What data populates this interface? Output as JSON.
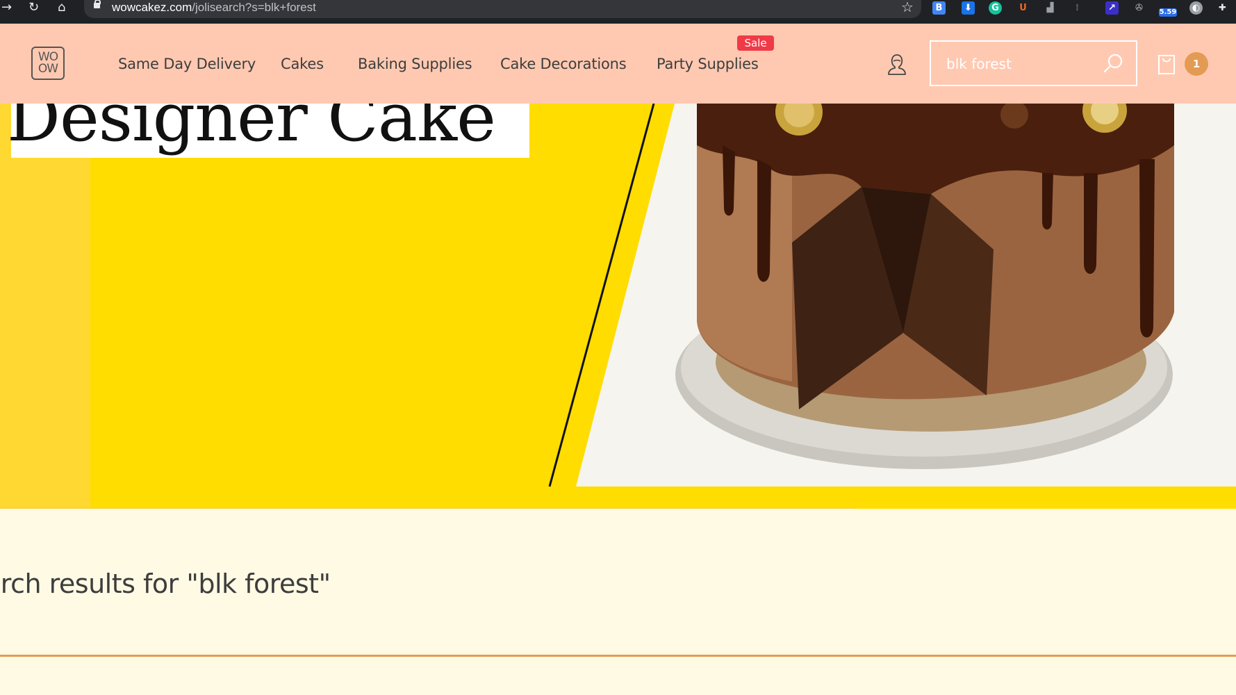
{
  "browser": {
    "url_host": "wowcakez.com",
    "url_path": "/jolisearch?s=blk+forest",
    "extension_badge": "5.59"
  },
  "header": {
    "logo_text": "WO OW",
    "nav": [
      {
        "label": "Same Day Delivery"
      },
      {
        "label": "Cakes"
      },
      {
        "label": "Baking Supplies"
      },
      {
        "label": "Cake Decorations"
      },
      {
        "label": "Party Supplies",
        "badge": "Sale"
      }
    ],
    "search": {
      "value": "blk forest"
    },
    "cart_count": "1"
  },
  "hero": {
    "title": "Designer Cake"
  },
  "results": {
    "heading": "arch results for \"blk forest\""
  },
  "colors": {
    "header_bg": "#ffc9b1",
    "hero_yellow": "#ffdd00",
    "page_bg": "#fefae4",
    "accent": "#e39a53",
    "sale": "#f03a47"
  }
}
